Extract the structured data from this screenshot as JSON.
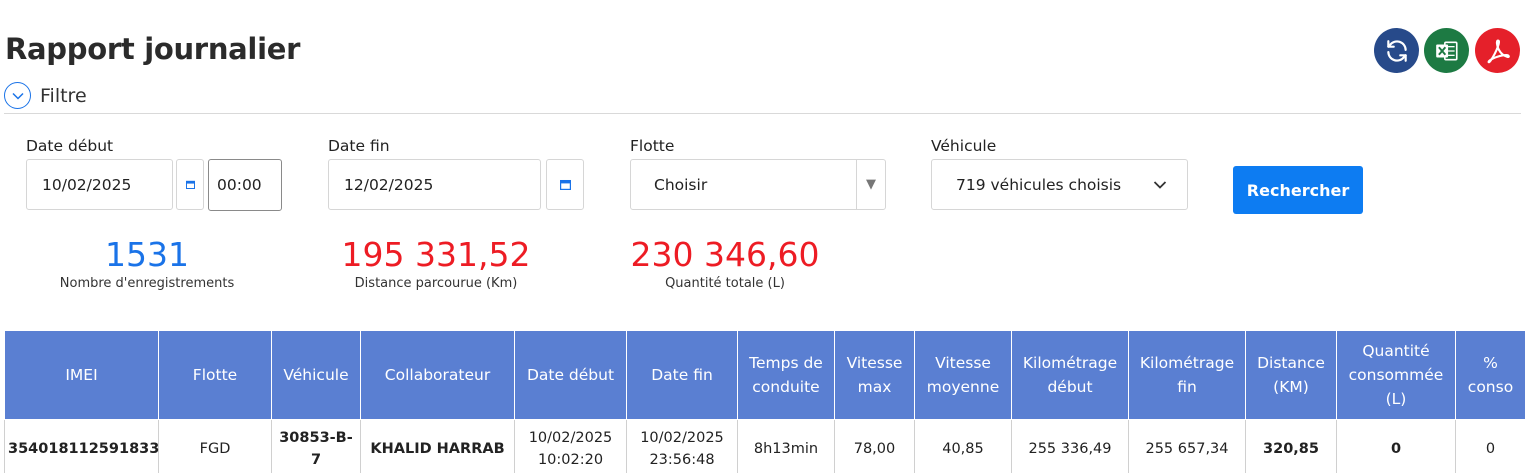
{
  "page": {
    "title": "Rapport journalier"
  },
  "actions": {
    "refresh_icon": "refresh-icon",
    "excel_icon": "excel-icon",
    "pdf_icon": "pdf-icon"
  },
  "filter": {
    "label": "Filtre"
  },
  "form": {
    "date_start": {
      "label": "Date début",
      "value": "10/02/2025",
      "time": "00:00"
    },
    "date_end": {
      "label": "Date fin",
      "value": "12/02/2025"
    },
    "fleet": {
      "label": "Flotte",
      "value": "Choisir"
    },
    "vehicle": {
      "label": "Véhicule",
      "value": "719 véhicules choisis"
    },
    "search_label": "Rechercher"
  },
  "stats": {
    "records": {
      "value": "1531",
      "label": "Nombre d'enregistrements"
    },
    "distance": {
      "value": "195 331,52",
      "label": "Distance parcourue (Km)"
    },
    "quantity": {
      "value": "230 346,60",
      "label": "Quantité totale (L)"
    }
  },
  "table": {
    "headers": [
      "IMEI",
      "Flotte",
      "Véhicule",
      "Collaborateur",
      "Date début",
      "Date fin",
      "Temps de conduite",
      "Vitesse max",
      "Vitesse moyenne",
      "Kilométrage début",
      "Kilométrage fin",
      "Distance (KM)",
      "Quantité consommée (L)",
      "% conso"
    ],
    "rows": [
      {
        "imei": "354018112591833",
        "fleet": "FGD",
        "vehicle": "30853-B-7",
        "collaborator": "KHALID HARRAB",
        "date_start": "10/02/2025 10:02:20",
        "date_end": "10/02/2025 23:56:48",
        "driving_time": "8h13min",
        "speed_max": "78,00",
        "speed_avg": "40,85",
        "km_start": "255 336,49",
        "km_end": "255 657,34",
        "distance": "320,85",
        "quantity": "0",
        "conso": "0"
      }
    ]
  },
  "colors": {
    "header_bg": "#5a7fd2",
    "primary": "#0d7cf2",
    "accent_red": "#ed1c24",
    "green": "#15a030"
  }
}
